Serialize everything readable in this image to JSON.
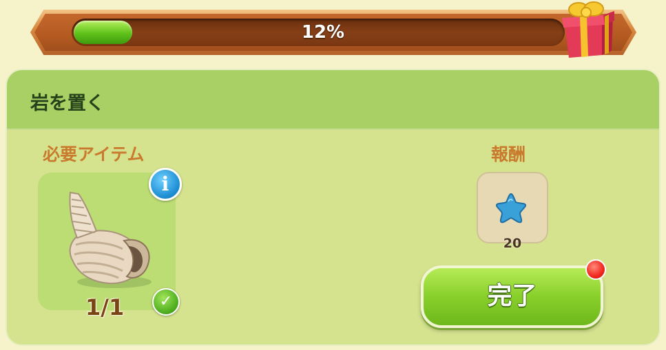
{
  "progress": {
    "label": "12%",
    "value": 0.12
  },
  "quest": {
    "title": "岩を置く"
  },
  "required": {
    "heading": "必要アイテム",
    "item_icon": "conch-shell-icon",
    "count": "1/1",
    "info_glyph": "i",
    "check_glyph": "✓"
  },
  "reward": {
    "heading": "報酬",
    "icon": "blue-star-icon",
    "amount": "20"
  },
  "actions": {
    "complete_label": "完了"
  },
  "colors": {
    "progress_fill": "#5fc11a",
    "panel_bg": "#d5e38f",
    "header_bg": "#a9d064",
    "label_orange": "#c97a2c",
    "button_green": "#88cf2a",
    "notification_red": "#f1271f"
  }
}
